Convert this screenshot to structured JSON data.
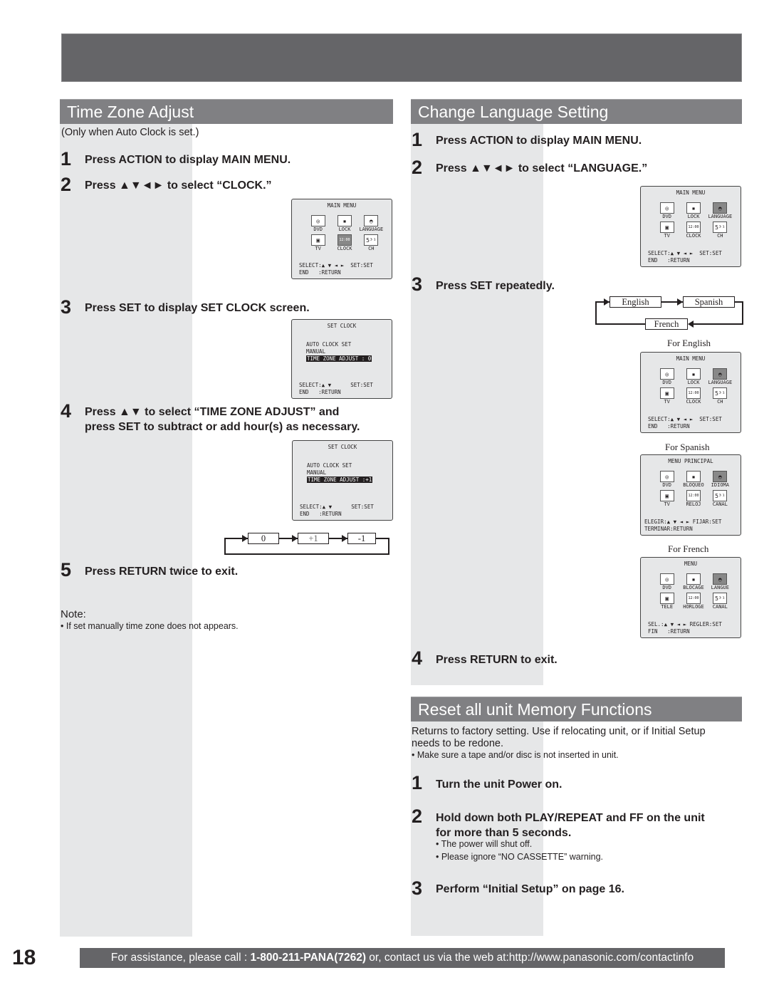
{
  "page_number": "18",
  "time_zone": {
    "header": "Time Zone Adjust",
    "condition": "(Only when Auto Clock is set.)",
    "steps": [
      {
        "num": "1",
        "text": "Press ACTION to display MAIN MENU."
      },
      {
        "num": "2",
        "text": "Press ▲▼◄► to select “CLOCK.”"
      },
      {
        "num": "3",
        "text": "Press SET to display SET CLOCK screen."
      },
      {
        "num": "4",
        "text": "Press ▲▼ to select “TIME ZONE ADJUST” and",
        "text2": "press SET to subtract or add hour(s) as necessary."
      },
      {
        "num": "5",
        "text": "Press RETURN twice to exit."
      }
    ],
    "note_label": "Note:",
    "note_text": "•  If set manually time zone does not appears.",
    "cycle": [
      "0",
      "+1",
      "-1"
    ]
  },
  "osd_main_menu": {
    "title": "MAIN MENU",
    "icons": [
      {
        "glyph": "◎",
        "label": "DVD",
        "icon": "disc-icon"
      },
      {
        "glyph": "▪",
        "label": "LOCK",
        "icon": "lock-icon"
      },
      {
        "glyph": "◓",
        "label": "LANGUAGE",
        "icon": "lips-icon"
      },
      {
        "glyph": "▣",
        "label": "TV",
        "icon": "tv-icon"
      },
      {
        "glyph": "12:00",
        "label": "CLOCK",
        "icon": "clock-icon"
      },
      {
        "glyph": "5³¹",
        "label": "CH",
        "icon": "channel-icon"
      }
    ],
    "footer": "SELECT:▲ ▼ ◄ ►  SET:SET\nEND   :RETURN"
  },
  "osd_set_clock": {
    "title": "SET CLOCK",
    "items": [
      "AUTO CLOCK SET",
      "MANUAL"
    ],
    "highlight_0": "TIME ZONE ADJUST : 0",
    "highlight_1": "TIME ZONE ADJUST :+1",
    "footer": "SELECT:▲ ▼      SET:SET\nEND   :RETURN"
  },
  "language": {
    "header": "Change Language Setting",
    "steps": [
      {
        "num": "1",
        "text": "Press ACTION to display MAIN MENU."
      },
      {
        "num": "2",
        "text": "Press ▲▼◄► to select “LANGUAGE.”"
      },
      {
        "num": "3",
        "text": "Press SET repeatedly."
      },
      {
        "num": "4",
        "text": "Press RETURN to exit."
      }
    ],
    "cycle": [
      "English",
      "Spanish",
      "French"
    ],
    "captions": {
      "english": "For English",
      "spanish": "For Spanish",
      "french": "For French"
    }
  },
  "osd_spanish": {
    "title": "MENU PRINCIPAL",
    "labels": [
      "DVD",
      "BLOQUEO",
      "IDIOMA",
      "TV",
      "RELOJ",
      "CANAL"
    ],
    "footer": "ELEGIR:▲ ▼ ◄ ► FIJAR:SET\nTERMINAR:RETURN"
  },
  "osd_french": {
    "title": "MENU",
    "labels": [
      "DVD",
      "BLOCAGE",
      "LANGUE",
      "TELE",
      "HORLOGE",
      "CANAL"
    ],
    "footer": "SEL.:▲ ▼ ◄ ► REGLER:SET\nFIN   :RETURN"
  },
  "reset": {
    "header": "Reset all unit Memory Functions",
    "intro_line1": "Returns to factory setting. Use if relocating unit, or if Initial Setup",
    "intro_line2": "needs to be redone.",
    "bullet": "• Make sure a tape and/or disc is not inserted in unit.",
    "steps": [
      {
        "num": "1",
        "text": "Turn the unit Power on."
      },
      {
        "num": "2",
        "text": "Hold down both PLAY/REPEAT and FF on the unit",
        "text2": "for more than 5 seconds."
      },
      {
        "num": "3",
        "text": "Perform “Initial Setup” on page 16."
      }
    ],
    "step2_bullets": [
      "• The power will shut off.",
      "• Please ignore “NO CASSETTE” warning."
    ]
  },
  "footer": {
    "prefix": "For assistance, please call : ",
    "phone": "1-800-211-PANA(7262)",
    "suffix": " or, contact us via the web at:http://www.panasonic.com/contactinfo"
  }
}
